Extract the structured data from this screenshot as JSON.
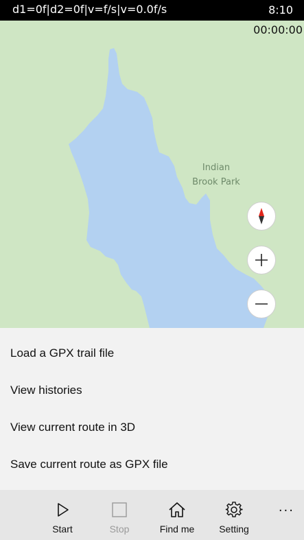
{
  "status_bar": {
    "left_text": "d1=0f|d2=0f|v=f/s|v=0.0f/s",
    "time": "8:10"
  },
  "map": {
    "timer": "00:00:00",
    "park_label_line1": "Indian",
    "park_label_line2": "Brook Park",
    "land_color": "#cfe6c4",
    "water_color": "#b3d1f1"
  },
  "menu": {
    "items": [
      {
        "label": "Load a GPX trail file"
      },
      {
        "label": "View histories"
      },
      {
        "label": "View current route in 3D"
      },
      {
        "label": "Save current route as GPX file"
      }
    ]
  },
  "app_bar": {
    "start_label": "Start",
    "stop_label": "Stop",
    "find_me_label": "Find me",
    "setting_label": "Setting",
    "more_glyph": "···"
  }
}
